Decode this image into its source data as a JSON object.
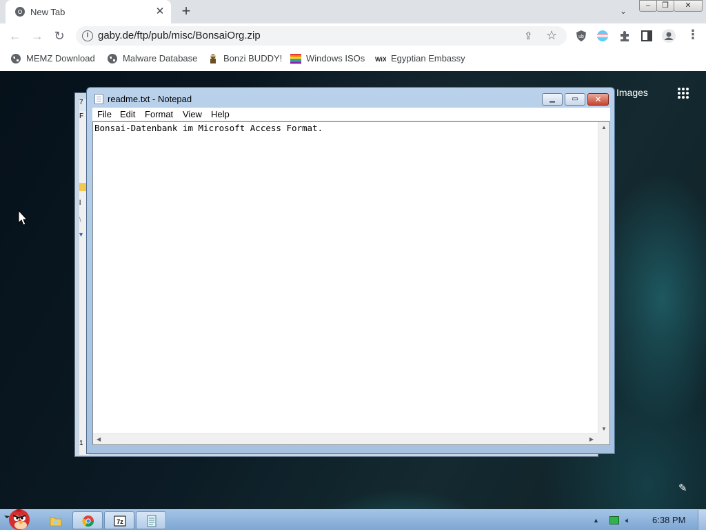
{
  "browser": {
    "tab": {
      "title": "New Tab",
      "favicon": "chrome-icon",
      "close_glyph": "✕"
    },
    "new_tab_glyph": "+",
    "tab_search_glyph": "⌄",
    "window_controls": {
      "minimize": "–",
      "maximize": "❐",
      "close": "✕"
    },
    "nav": {
      "back": "←",
      "forward": "→",
      "reload": "↻"
    },
    "url": "gaby.de/ftp/pub/misc/BonsaiOrg.zip",
    "extensions": [
      "ublock-icon",
      "flag-icon",
      "puzzle-icon",
      "sidepanel-icon",
      "profile-icon"
    ],
    "bookmarks": [
      {
        "label": "MEMZ Download",
        "icon": "globe-icon"
      },
      {
        "label": "Malware Database",
        "icon": "globe-icon"
      },
      {
        "label": "Bonzi BUDDY!",
        "icon": "bonzi-icon"
      },
      {
        "label": "Windows ISOs",
        "icon": "windows-flag-icon"
      },
      {
        "label": "Egyptian Embassy",
        "icon": "wix-icon"
      }
    ],
    "page_links": {
      "images": "Images"
    }
  },
  "notepad": {
    "title": "readme.txt - Notepad",
    "menu": [
      "File",
      "Edit",
      "Format",
      "View",
      "Help"
    ],
    "content": "Bonsai-Datenbank im Microsoft Access Format.",
    "buttons": {
      "minimize": "▁",
      "maximize": "▭",
      "close": "✕"
    }
  },
  "background_window": {
    "strip_chars": [
      "7",
      "F",
      "",
      "l",
      "\\",
      "1"
    ]
  },
  "taskbar": {
    "items": [
      "angry-bird-start-icon",
      "folder-icon",
      "chrome-icon",
      "7zip-icon",
      "notepad-icon"
    ],
    "clock": "6:38 PM"
  },
  "colors": {
    "taskbar": "#8fb4dd",
    "notepad_frame": "#b9d1ea",
    "omnibox": "#f1f3f4"
  }
}
